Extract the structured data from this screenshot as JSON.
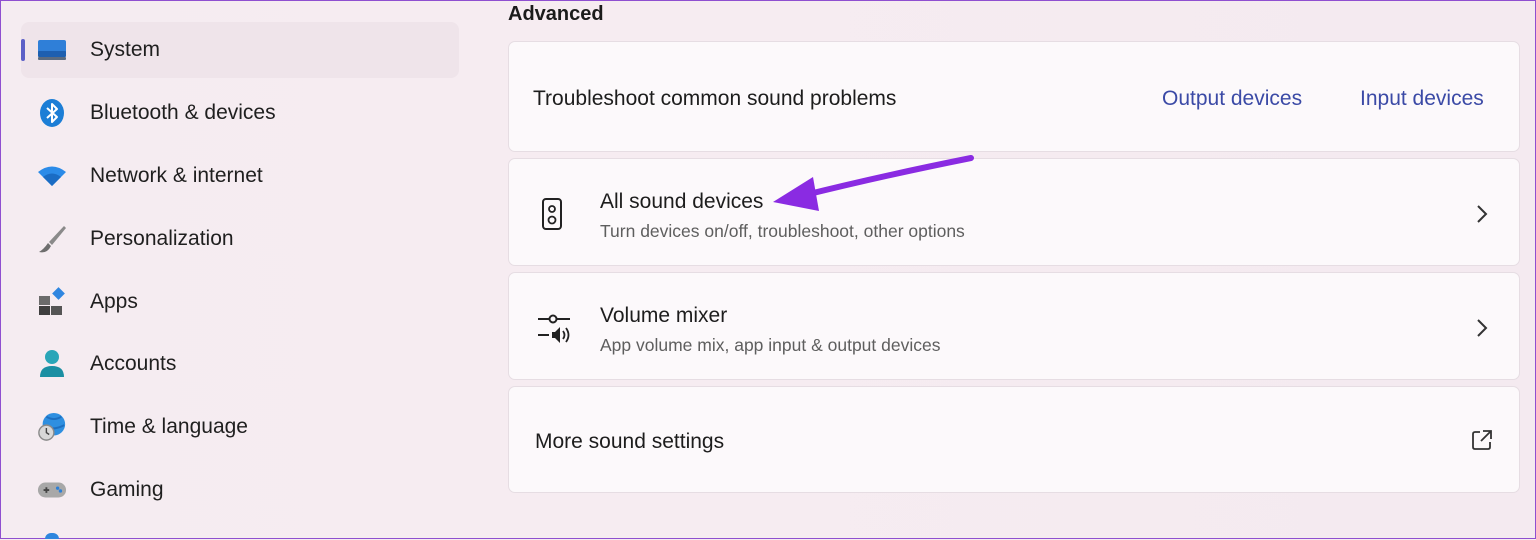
{
  "sidebar": {
    "items": [
      {
        "label": "System",
        "icon": "system-icon",
        "selected": true
      },
      {
        "label": "Bluetooth & devices",
        "icon": "bluetooth-icon"
      },
      {
        "label": "Network & internet",
        "icon": "wifi-icon"
      },
      {
        "label": "Personalization",
        "icon": "brush-icon"
      },
      {
        "label": "Apps",
        "icon": "apps-icon"
      },
      {
        "label": "Accounts",
        "icon": "person-icon"
      },
      {
        "label": "Time & language",
        "icon": "clock-globe-icon"
      },
      {
        "label": "Gaming",
        "icon": "gamepad-icon"
      }
    ]
  },
  "main": {
    "section_title": "Advanced",
    "troubleshoot": {
      "title": "Troubleshoot common sound problems",
      "output_link": "Output devices",
      "input_link": "Input devices"
    },
    "all_sound_devices": {
      "title": "All sound devices",
      "subtitle": "Turn devices on/off, troubleshoot, other options",
      "icon": "speaker-icon"
    },
    "volume_mixer": {
      "title": "Volume mixer",
      "subtitle": "App volume mix, app input & output devices",
      "icon": "volume-mixer-icon"
    },
    "more_sound_settings": {
      "title": "More sound settings",
      "icon": "open-external-icon"
    }
  },
  "colors": {
    "accent": "#5b5fc7",
    "link": "#3b4aa6",
    "annotation_arrow": "#8a2be2"
  }
}
